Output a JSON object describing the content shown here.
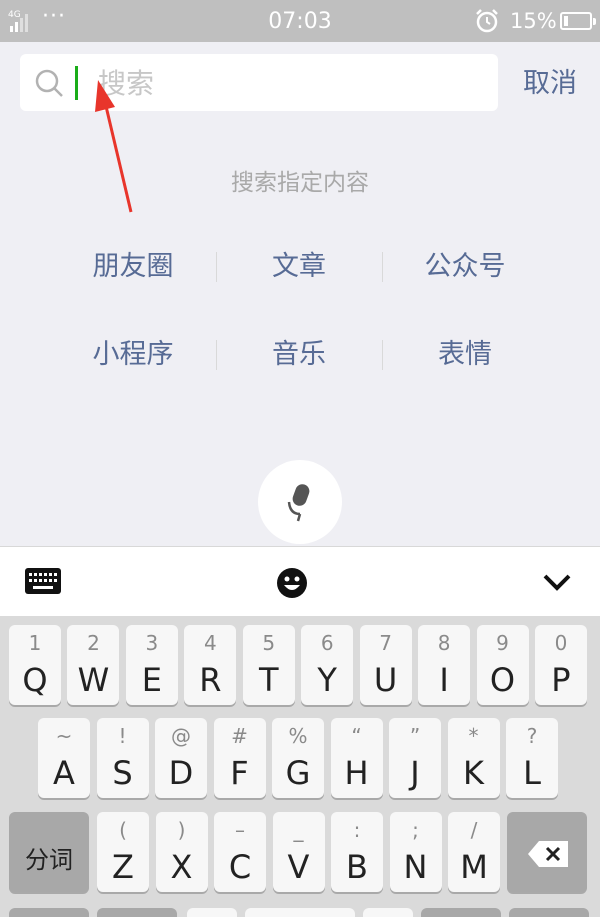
{
  "status_bar": {
    "network": "4G",
    "dots": "···",
    "time": "07:03",
    "battery_percent": "15%",
    "battery_level": 0.15
  },
  "search": {
    "placeholder": "搜索",
    "cancel_label": "取消",
    "hint": "搜索指定内容"
  },
  "categories": [
    [
      "朋友圈",
      "文章",
      "公众号"
    ],
    [
      "小程序",
      "音乐",
      "表情"
    ]
  ],
  "keyboard": {
    "row1": [
      {
        "sub": "1",
        "main": "Q"
      },
      {
        "sub": "2",
        "main": "W"
      },
      {
        "sub": "3",
        "main": "E"
      },
      {
        "sub": "4",
        "main": "R"
      },
      {
        "sub": "5",
        "main": "T"
      },
      {
        "sub": "6",
        "main": "Y"
      },
      {
        "sub": "7",
        "main": "U"
      },
      {
        "sub": "8",
        "main": "I"
      },
      {
        "sub": "9",
        "main": "O"
      },
      {
        "sub": "0",
        "main": "P"
      }
    ],
    "row2": [
      {
        "sub": "~",
        "main": "A"
      },
      {
        "sub": "!",
        "main": "S"
      },
      {
        "sub": "@",
        "main": "D"
      },
      {
        "sub": "#",
        "main": "F"
      },
      {
        "sub": "%",
        "main": "G"
      },
      {
        "sub": "“",
        "main": "H"
      },
      {
        "sub": "”",
        "main": "J"
      },
      {
        "sub": "*",
        "main": "K"
      },
      {
        "sub": "?",
        "main": "L"
      }
    ],
    "row3": [
      {
        "sub": "(",
        "main": "Z"
      },
      {
        "sub": ")",
        "main": "X"
      },
      {
        "sub": "–",
        "main": "C"
      },
      {
        "sub": "_",
        "main": "V"
      },
      {
        "sub": ":",
        "main": "B"
      },
      {
        "sub": ";",
        "main": "N"
      },
      {
        "sub": "/",
        "main": "M"
      }
    ],
    "segment_label": "分词"
  },
  "colors": {
    "link": "#576b95",
    "cursor": "#1aad19",
    "arrow": "#e8352b"
  },
  "icons": [
    "signal-icon",
    "alarm-icon",
    "battery-icon",
    "search-icon",
    "microphone-icon",
    "keyboard-icon",
    "emoji-icon",
    "chevron-down-icon",
    "backspace-icon"
  ]
}
